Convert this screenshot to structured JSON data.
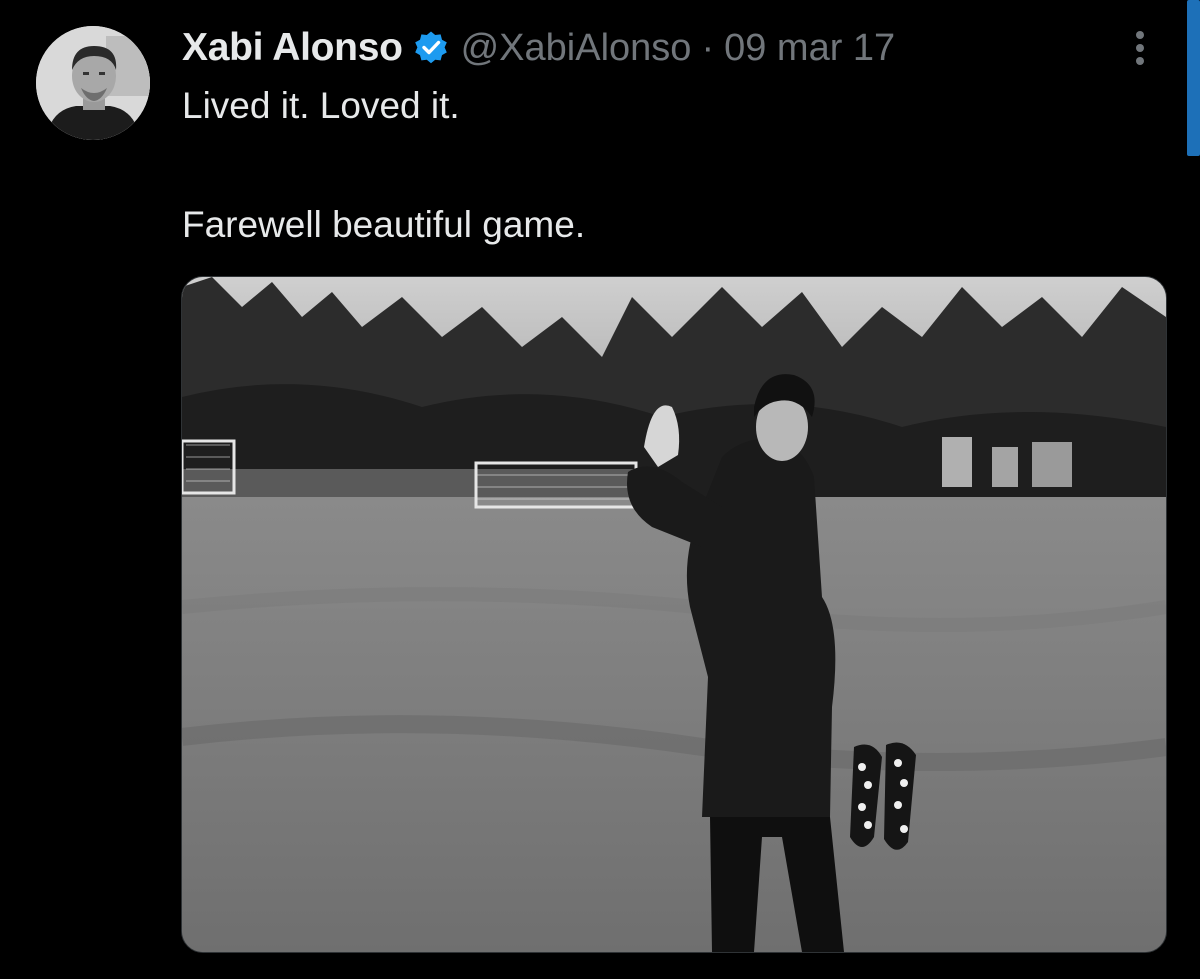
{
  "author": {
    "display_name": "Xabi Alonso",
    "handle": "@XabiAlonso",
    "separator": "·",
    "date": "09 mar 17",
    "verified": true,
    "avatar_description": "profile-photo"
  },
  "tweet": {
    "lines": [
      "Lived it. Loved it.",
      "Farewell beautiful game."
    ]
  },
  "media": {
    "type": "black-and-white photo"
  },
  "icons": {
    "verified": "verified-badge-icon",
    "more": "more-options-icon"
  },
  "colors": {
    "background": "#000000",
    "primary_text": "#e7e9ea",
    "secondary_text": "#71767b",
    "verified_blue": "#1d9bf0",
    "scrollbar": "#1d70b8"
  }
}
